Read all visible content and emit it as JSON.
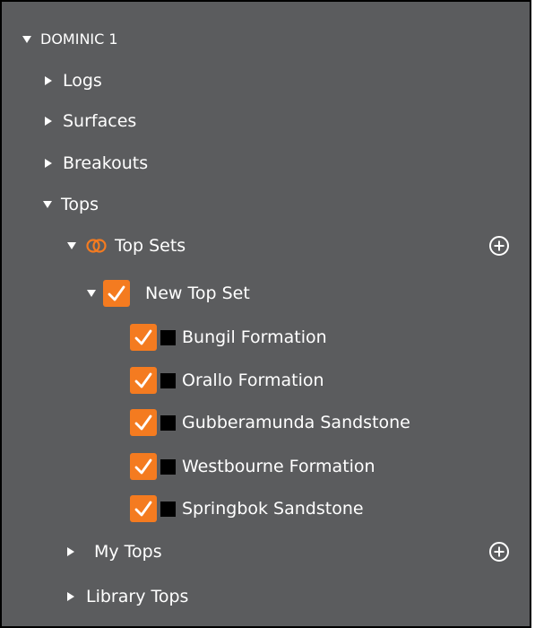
{
  "tree": {
    "root_label": "DOMINIC 1",
    "logs_label": "Logs",
    "surfaces_label": "Surfaces",
    "breakouts_label": "Breakouts",
    "tops_label": "Tops",
    "top_sets_label": "Top Sets",
    "new_top_set_label": "New Top Set",
    "formations": [
      {
        "label": "Bungil Formation",
        "checked": true,
        "color": "#000000"
      },
      {
        "label": "Orallo Formation",
        "checked": true,
        "color": "#000000"
      },
      {
        "label": "Gubberamunda Sandstone",
        "checked": true,
        "color": "#000000"
      },
      {
        "label": "Westbourne Formation",
        "checked": true,
        "color": "#000000"
      },
      {
        "label": "Springbok Sandstone",
        "checked": true,
        "color": "#000000"
      }
    ],
    "my_tops_label": "My Tops",
    "library_tops_label": "Library Tops"
  },
  "colors": {
    "panel_bg": "#5b5c5e",
    "accent": "#f47b20",
    "text": "#ffffff"
  },
  "icons": {
    "expanded": "triangle-down",
    "collapsed": "triangle-right",
    "add": "plus-circle",
    "top-sets": "linked-rings",
    "checked": "checkmark"
  }
}
